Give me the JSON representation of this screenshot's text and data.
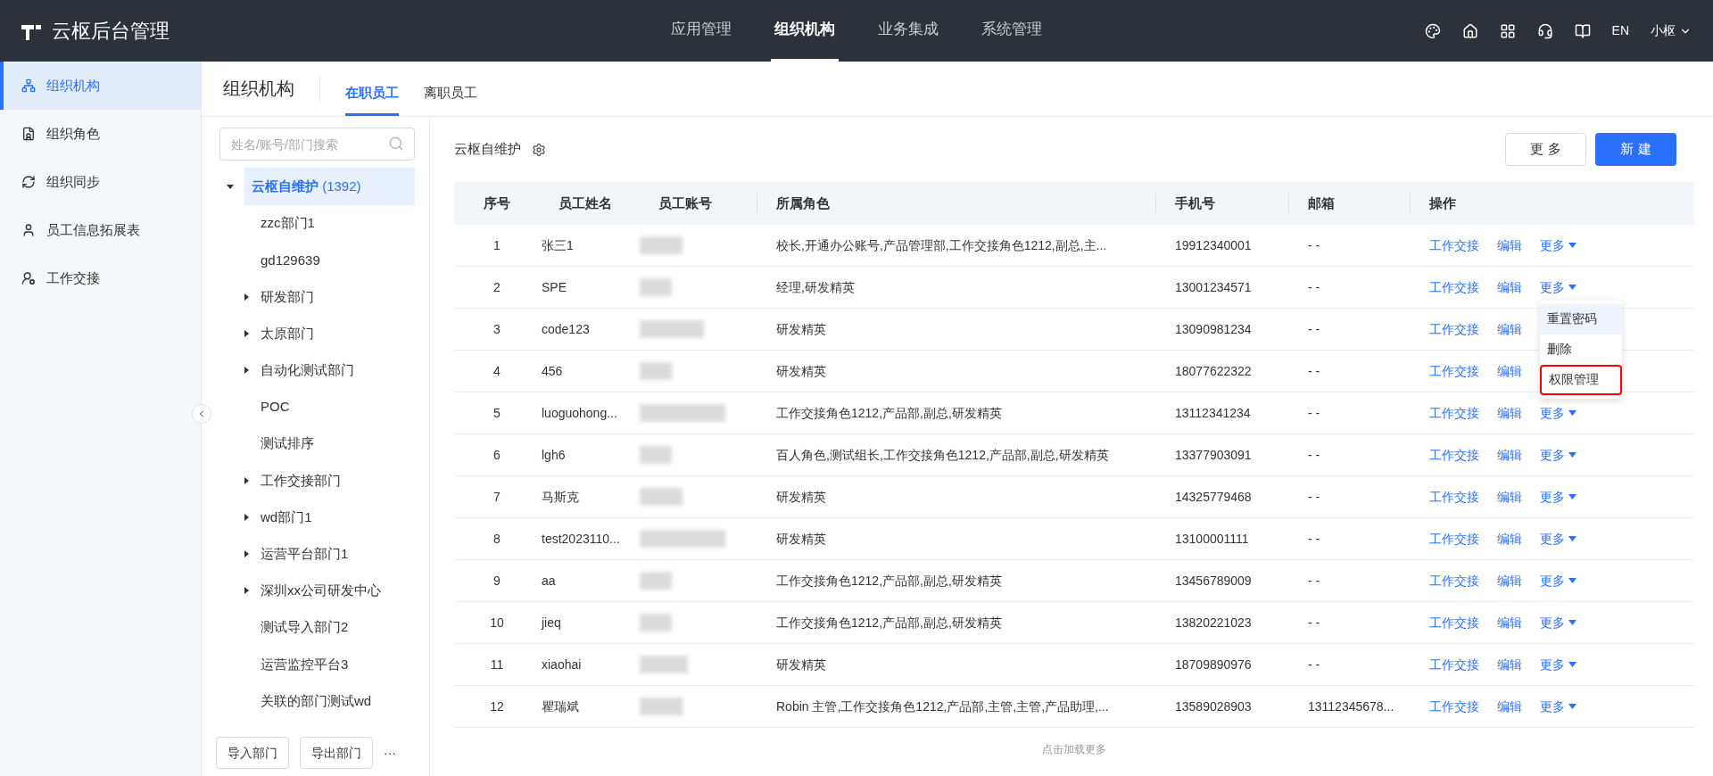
{
  "header": {
    "logo_text": "云枢后台管理",
    "nav": [
      {
        "label": "应用管理",
        "selected": false
      },
      {
        "label": "组织机构",
        "selected": true
      },
      {
        "label": "业务集成",
        "selected": false
      },
      {
        "label": "系统管理",
        "selected": false
      }
    ],
    "lang": "EN",
    "user": "小枢"
  },
  "sidebar": {
    "items": [
      {
        "label": "组织机构",
        "selected": true
      },
      {
        "label": "组织角色",
        "selected": false
      },
      {
        "label": "组织同步",
        "selected": false
      },
      {
        "label": "员工信息拓展表",
        "selected": false
      },
      {
        "label": "工作交接",
        "selected": false
      }
    ]
  },
  "page_title": "组织机构",
  "tabs": [
    {
      "label": "在职员工",
      "selected": true
    },
    {
      "label": "离职员工",
      "selected": false
    }
  ],
  "tree": {
    "search": {
      "placeholder": "姓名/账号/部门搜索"
    },
    "root": {
      "label": "云枢自维护",
      "count": "(1392)",
      "expanded": true,
      "selected": true,
      "children": [
        {
          "label": "zzc部门1",
          "has_children": false
        },
        {
          "label": "gd129639",
          "has_children": false
        },
        {
          "label": "研发部门",
          "has_children": true
        },
        {
          "label": "太原部门",
          "has_children": true
        },
        {
          "label": "自动化测试部门",
          "has_children": true
        },
        {
          "label": "POC",
          "has_children": false
        },
        {
          "label": "测试排序",
          "has_children": false
        },
        {
          "label": "工作交接部门",
          "has_children": true
        },
        {
          "label": "wd部门1",
          "has_children": true
        },
        {
          "label": "运营平台部门1",
          "has_children": true
        },
        {
          "label": "深圳xx公司研发中心",
          "has_children": true
        },
        {
          "label": "测试导入部门2",
          "has_children": false
        },
        {
          "label": "运营监控平台3",
          "has_children": false
        },
        {
          "label": "关联的部门测试wd",
          "has_children": false
        }
      ]
    },
    "buttons": [
      "导入部门",
      "导出部门"
    ],
    "more": "···"
  },
  "content": {
    "title": "云枢自维护",
    "buttons": [
      {
        "label": "更 多",
        "kind": "secondary"
      },
      {
        "label": "新 建",
        "kind": "primary"
      }
    ],
    "table": {
      "columns": [
        "序号",
        "员工姓名",
        "员工账号",
        "所属角色",
        "手机号",
        "邮箱",
        "操作"
      ],
      "rows": [
        {
          "index": "1",
          "name": "张三1",
          "roles": "校长,开通办公账号,产品管理部,工作交接角色1212,副总,主...",
          "phone": "19912340001",
          "email": "- -",
          "actions": [
            "工作交接",
            "编辑",
            "更多"
          ]
        },
        {
          "index": "2",
          "name": "SPE",
          "roles": "经理,研发精英",
          "phone": "13001234571",
          "email": "- -",
          "actions": [
            "工作交接",
            "编辑",
            "更多"
          ],
          "menu": [
            {
              "label": "重置密码",
              "hovered": true,
              "annotated": false
            },
            {
              "label": "删除",
              "hovered": false,
              "annotated": false
            },
            {
              "label": "权限管理",
              "hovered": false,
              "annotated": true
            }
          ]
        },
        {
          "index": "3",
          "name": "code123",
          "roles": "研发精英",
          "phone": "13090981234",
          "email": "- -",
          "actions": [
            "工作交接",
            "编辑"
          ]
        },
        {
          "index": "4",
          "name": "456",
          "roles": "研发精英",
          "phone": "18077622322",
          "email": "- -",
          "actions": [
            "工作交接",
            "编辑"
          ]
        },
        {
          "index": "5",
          "name": "luoguohong...",
          "roles": "工作交接角色1212,产品部,副总,研发精英",
          "phone": "13112341234",
          "email": "- -",
          "actions": [
            "工作交接",
            "编辑",
            "更多"
          ]
        },
        {
          "index": "6",
          "name": "lgh6",
          "roles": "百人角色,测试组长,工作交接角色1212,产品部,副总,研发精英",
          "phone": "13377903091",
          "email": "- -",
          "actions": [
            "工作交接",
            "编辑",
            "更多"
          ]
        },
        {
          "index": "7",
          "name": "马斯克",
          "roles": "研发精英",
          "phone": "14325779468",
          "email": "- -",
          "actions": [
            "工作交接",
            "编辑",
            "更多"
          ]
        },
        {
          "index": "8",
          "name": "test2023110...",
          "roles": "研发精英",
          "phone": "13100001111",
          "email": "- -",
          "actions": [
            "工作交接",
            "编辑",
            "更多"
          ]
        },
        {
          "index": "9",
          "name": "aa",
          "roles": "工作交接角色1212,产品部,副总,研发精英",
          "phone": "13456789009",
          "email": "- -",
          "actions": [
            "工作交接",
            "编辑",
            "更多"
          ]
        },
        {
          "index": "10",
          "name": "jieq",
          "roles": "工作交接角色1212,产品部,副总,研发精英",
          "phone": "13820221023",
          "email": "- -",
          "actions": [
            "工作交接",
            "编辑",
            "更多"
          ]
        },
        {
          "index": "11",
          "name": "xiaohai",
          "roles": "研发精英",
          "phone": "18709890976",
          "email": "- -",
          "actions": [
            "工作交接",
            "编辑",
            "更多"
          ]
        },
        {
          "index": "12",
          "name": "瞿瑞斌",
          "roles": "Robin 主管,工作交接角色1212,产品部,主管,主管,产品助理,...",
          "phone": "13589028903",
          "email": "13112345678...",
          "actions": [
            "工作交接",
            "编辑",
            "更多"
          ]
        }
      ]
    },
    "load_more": "点击加载更多"
  }
}
